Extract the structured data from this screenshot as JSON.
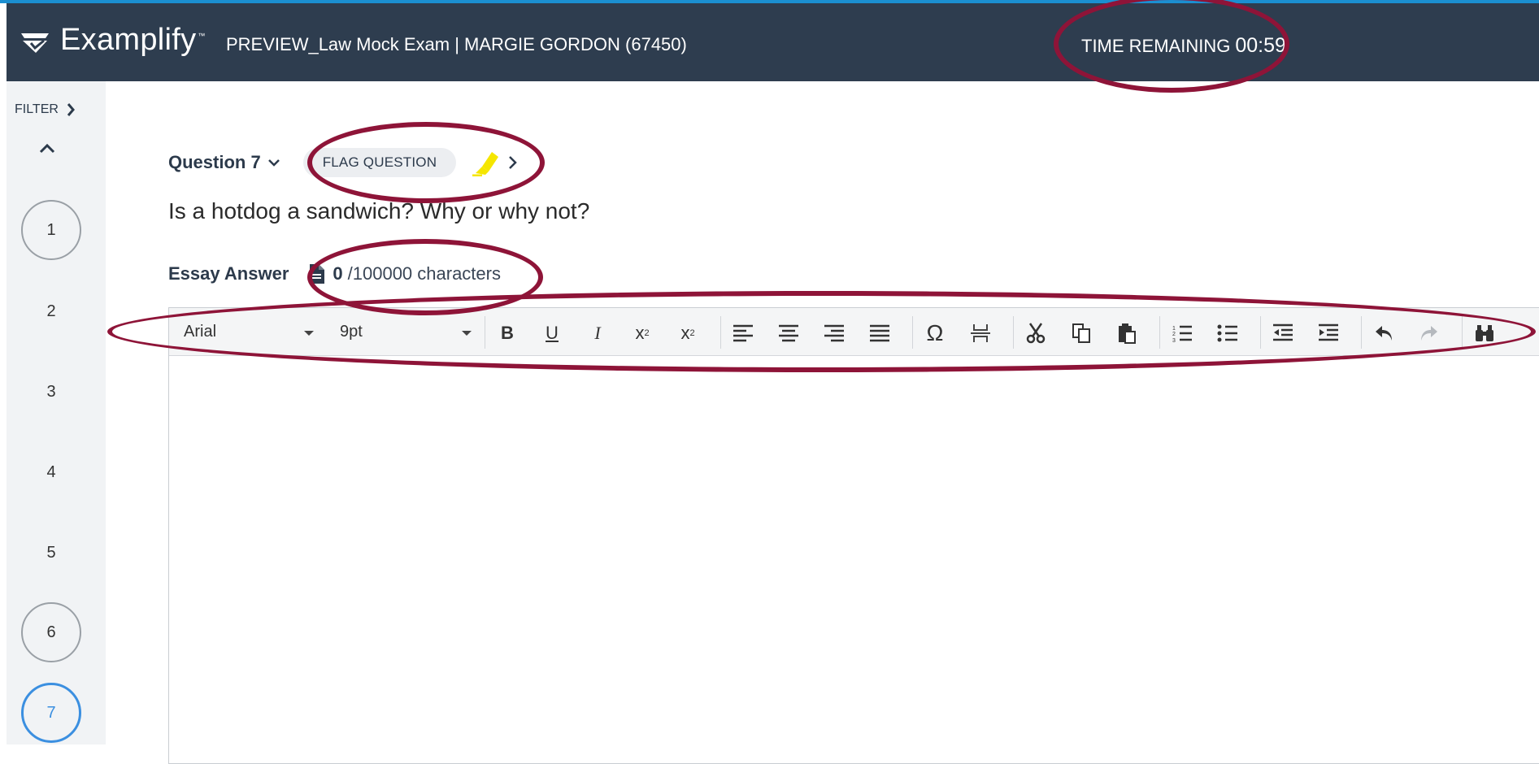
{
  "app": {
    "name": "Examplify",
    "trademark": "™",
    "exam_title": "PREVIEW_Law Mock Exam | MARGIE GORDON (67450)"
  },
  "timer": {
    "label": "TIME REMAINING",
    "value": "00:59"
  },
  "sidebar": {
    "filter_label": "FILTER",
    "questions": [
      {
        "num": "1",
        "state": "answered"
      },
      {
        "num": "2",
        "state": "plain"
      },
      {
        "num": "3",
        "state": "plain"
      },
      {
        "num": "4",
        "state": "plain"
      },
      {
        "num": "5",
        "state": "plain"
      },
      {
        "num": "6",
        "state": "answered"
      },
      {
        "num": "7",
        "state": "current"
      }
    ]
  },
  "question": {
    "label": "Question 7",
    "flag_label": "FLAG QUESTION",
    "text": "Is a hotdog a sandwich? Why or why not?"
  },
  "essay": {
    "label": "Essay Answer",
    "count": "0",
    "limit_text": "/100000 characters"
  },
  "toolbar": {
    "font_family": "Arial",
    "font_size": "9pt",
    "buttons": [
      "bold",
      "underline",
      "italic",
      "superscript",
      "subscript",
      "align-left",
      "align-center",
      "align-right",
      "justify",
      "special-character",
      "page-break",
      "cut",
      "copy",
      "paste",
      "numbered-list",
      "bulleted-list",
      "outdent",
      "indent",
      "undo",
      "redo",
      "find"
    ]
  },
  "colors": {
    "header_bg": "#2e3d4f",
    "annotation": "#8e1438",
    "current_question": "#3b8fe0",
    "highlighter": "#f5e600"
  }
}
